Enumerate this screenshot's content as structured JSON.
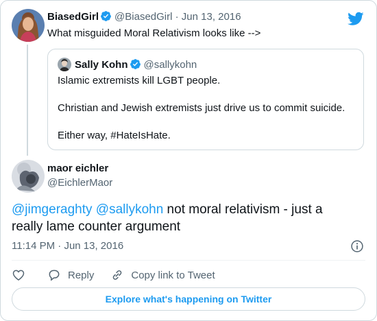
{
  "colors": {
    "accent": "#1d9bf0",
    "muted": "#536471",
    "text": "#0f1419",
    "border": "#cfd9de",
    "like": "#536471"
  },
  "tweet": {
    "author_name": "BiasedGirl",
    "author_handle": "@BiasedGirl",
    "separator": "·",
    "date": "Jun 13, 2016",
    "text": "What misguided Moral Relativism looks like -->",
    "quoted": {
      "author_name": "Sally Kohn",
      "author_handle": "@sallykohn",
      "lines": [
        "Islamic extremists kill LGBT people.",
        "Christian and Jewish extremists just drive us to commit suicide.",
        "Either way, #HateIsHate."
      ]
    }
  },
  "reply": {
    "author_name": "maor eichler",
    "author_handle": "@EichlerMaor",
    "mention1": "@jimgeraghty",
    "mention2": "@sallykohn",
    "text": " not moral relativism - just a really lame counter argument",
    "time": "11:14 PM",
    "separator": "·",
    "date": "Jun 13, 2016"
  },
  "actions": {
    "like_icon": "heart-icon",
    "reply_label": "Reply",
    "copy_label": "Copy link to Tweet"
  },
  "explore_label": "Explore what's happening on Twitter"
}
